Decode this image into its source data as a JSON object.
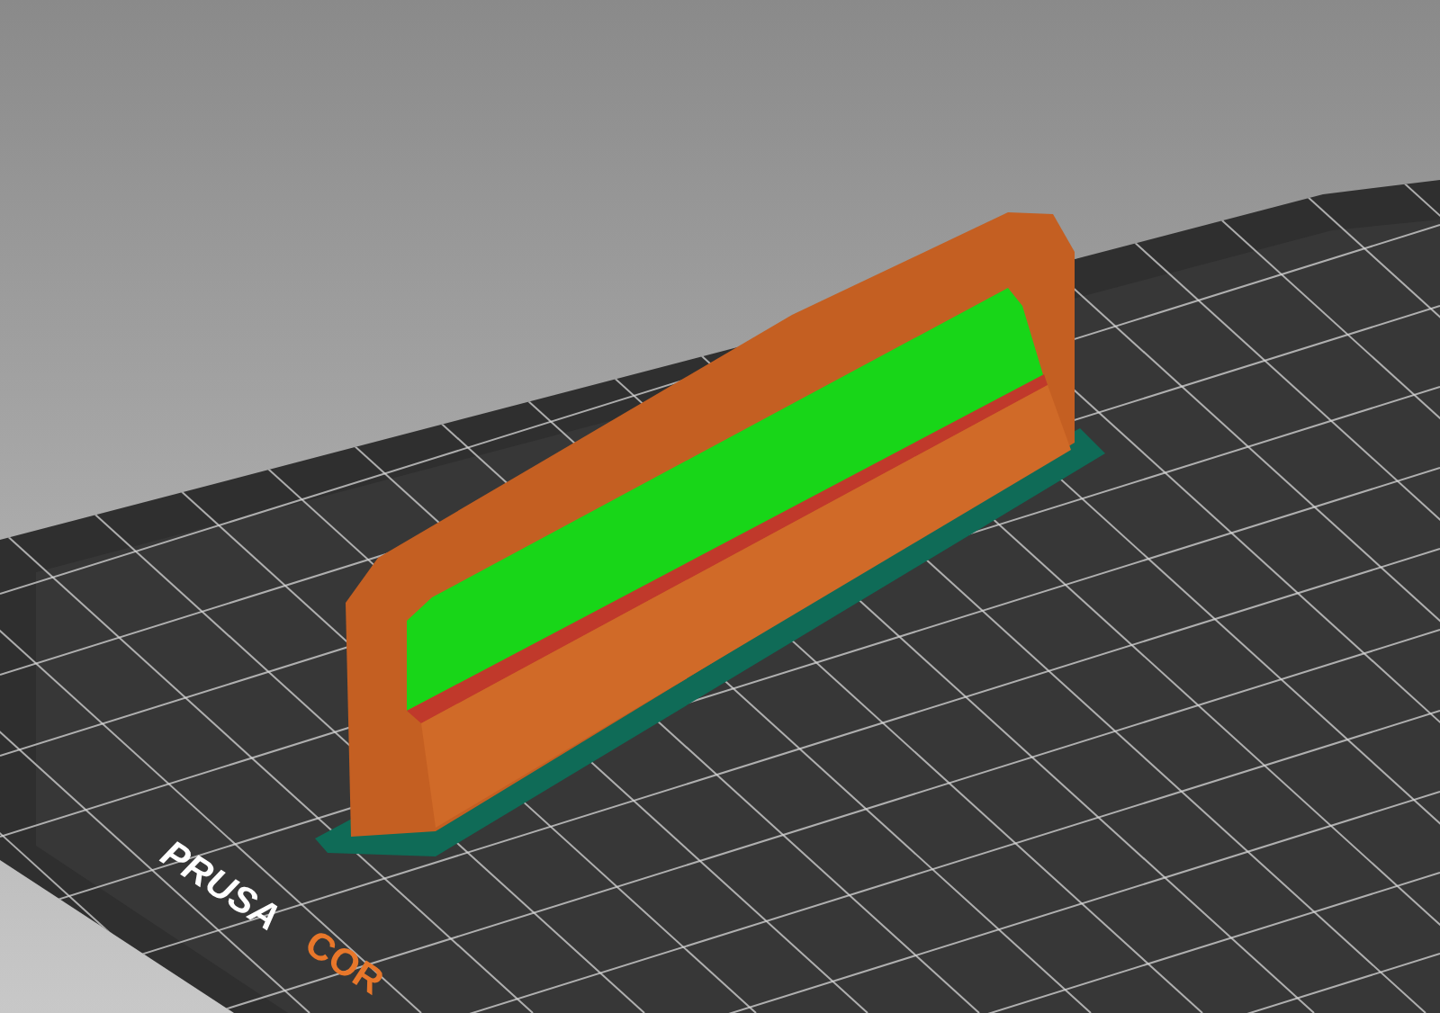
{
  "viewport": {
    "bed_logo": {
      "brand": "PRUSA",
      "model": "COR"
    }
  }
}
